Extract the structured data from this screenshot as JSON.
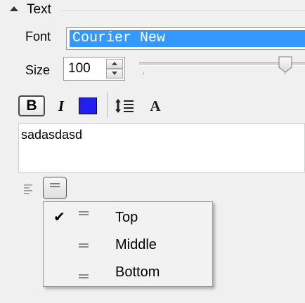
{
  "section": {
    "title": "Text"
  },
  "font": {
    "label": "Font",
    "value": "Courier New"
  },
  "size": {
    "label": "Size",
    "value": "100",
    "slider_level": 0.88
  },
  "toolbar": {
    "bold": "B",
    "italic": "I",
    "text_color": "#1f1ff0",
    "font_style_glyph": "A"
  },
  "text_area": {
    "content": "sadasdasd"
  },
  "vertical_align_menu": {
    "items": [
      {
        "label": "Top",
        "checked": true,
        "icon": "align-top-icon"
      },
      {
        "label": "Middle",
        "checked": false,
        "icon": "align-middle-icon"
      },
      {
        "label": "Bottom",
        "checked": false,
        "icon": "align-bottom-icon"
      }
    ],
    "checkmark": "✔"
  },
  "colors": {
    "selection": "#3399ff",
    "panel": "#f0f0f0"
  }
}
